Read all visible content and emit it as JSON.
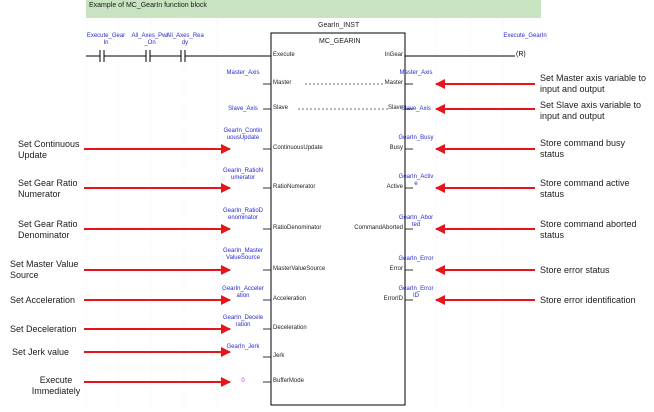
{
  "banner": "Example of MC_GearIn function block",
  "block": {
    "instance": "GearIn_INST",
    "type": "MC_GEARIN"
  },
  "contacts": [
    {
      "label": "Execute_GearIn"
    },
    {
      "label": "All_Axes_Pwr_On"
    },
    {
      "label": "All_Axes_Ready"
    }
  ],
  "coil": {
    "label": "Execute_GearIn",
    "symbol": "(R)"
  },
  "inputs": [
    {
      "pin": "Execute",
      "var": ""
    },
    {
      "pin": "Master",
      "var": "Master_Axis"
    },
    {
      "pin": "Slave",
      "var": "Slave_Axis"
    },
    {
      "pin": "ContinuousUpdate",
      "var": "GearIn_ContinuousUpdate"
    },
    {
      "pin": "RatioNumerator",
      "var": "GearIn_RatioNumerator"
    },
    {
      "pin": "RatioDenominator",
      "var": "GearIn_RatioDenominator"
    },
    {
      "pin": "MasterValueSource",
      "var": "GearIn_MasterValueSource"
    },
    {
      "pin": "Acceleration",
      "var": "GearIn_Acceleration"
    },
    {
      "pin": "Deceleration",
      "var": "GearIn_Deceleration"
    },
    {
      "pin": "Jerk",
      "var": "GearIn_Jerk"
    },
    {
      "pin": "BufferMode",
      "var": "0"
    }
  ],
  "outputs": [
    {
      "pin": "InGear",
      "var": ""
    },
    {
      "pin": "Master",
      "var": "Master_Axis"
    },
    {
      "pin": "Slave",
      "var": "Slave_Axis"
    },
    {
      "pin": "Busy",
      "var": "GearIn_Busy"
    },
    {
      "pin": "Active",
      "var": "GearIn_Active"
    },
    {
      "pin": "CommandAborted",
      "var": "GearIn_Aborted"
    },
    {
      "pin": "Error",
      "var": "GearIn_Error"
    },
    {
      "pin": "ErrorID",
      "var": "GearIn_ErrorID"
    }
  ],
  "left_notes": [
    "Set Continuous Update",
    "Set Gear Ratio Numerator",
    "Set Gear Ratio Denominator",
    "Set Master Value Source",
    "Set Acceleration",
    "Set Deceleration",
    "Set Jerk value",
    "Execute Immediately"
  ],
  "right_notes": [
    "Set Master axis variable to input and output",
    "Set Slave axis variable to input and output",
    "Store command busy status",
    "Store command active status",
    "Store command aborted status",
    "Store error status",
    "Store error identification"
  ],
  "colors": {
    "arrow": "#e8141c",
    "variable": "#2a2ad0",
    "banner": "#c7e3c0",
    "constant": "#e020e0"
  }
}
